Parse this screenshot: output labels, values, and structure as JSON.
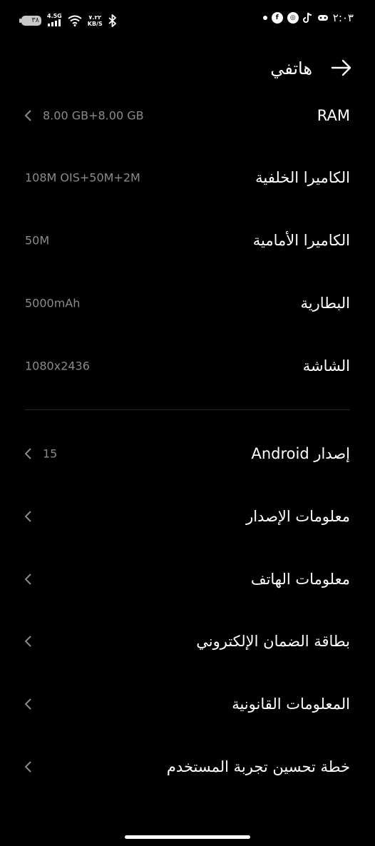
{
  "status_bar": {
    "time": "٢:٠٣",
    "battery": "٣٨",
    "network": "4.5G",
    "speed_value": "٧.٢٢",
    "speed_unit": "KB/S"
  },
  "header": {
    "title": "هاتفي"
  },
  "specs": [
    {
      "label": "RAM",
      "value": "8.00 GB+8.00 GB"
    },
    {
      "label": "الكاميرا الخلفية",
      "value": "108M OIS+50M+2M"
    },
    {
      "label": "الكاميرا الأمامية",
      "value": "50M"
    },
    {
      "label": "البطارية",
      "value": "5000mAh"
    },
    {
      "label": "الشاشة",
      "value": "1080x2436"
    }
  ],
  "android": {
    "label": "إصدار Android",
    "value": "15"
  },
  "menu": [
    {
      "label": "معلومات الإصدار"
    },
    {
      "label": "معلومات الهاتف"
    },
    {
      "label": "بطاقة الضمان الإلكتروني"
    },
    {
      "label": "المعلومات القانونية"
    },
    {
      "label": "خطة تحسين تجربة المستخدم"
    }
  ]
}
